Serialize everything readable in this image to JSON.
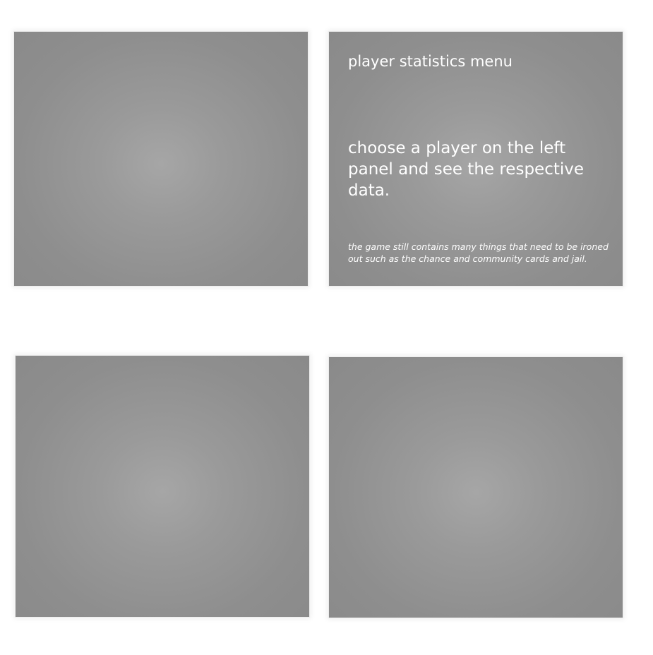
{
  "info_panel": {
    "title": "player statistics menu",
    "instruction": "choose a player on the left panel and see the respective data.",
    "note": "the game still contains many things that need to be ironed out such as the chance and community cards and jail."
  },
  "colors": {
    "background": "#ffffff",
    "panel_center": "#a6a6a6",
    "panel_edge": "#8a8a8a",
    "text": "#ffffff"
  }
}
